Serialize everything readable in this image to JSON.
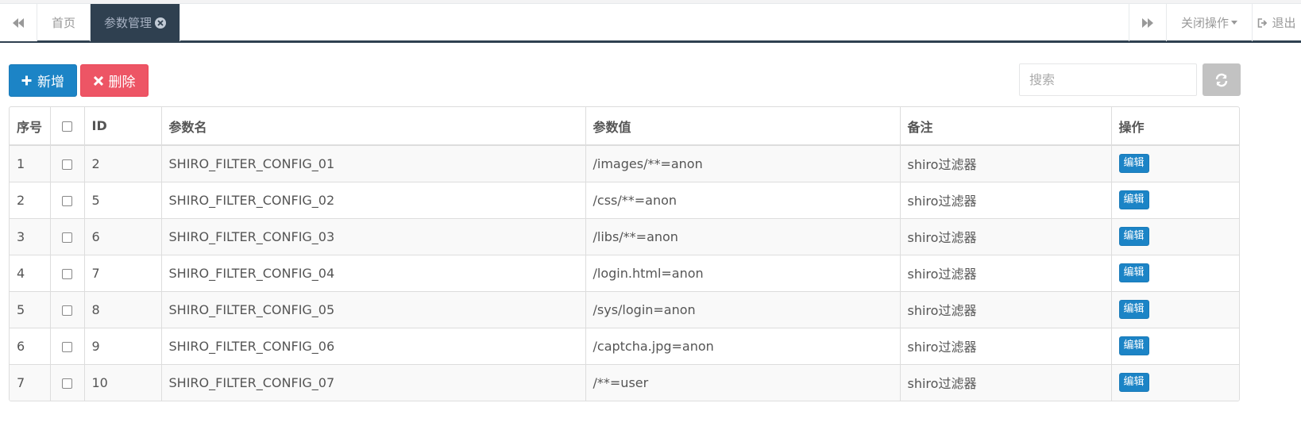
{
  "tabbar": {
    "tabs": [
      {
        "label": "首页",
        "active": false
      },
      {
        "label": "参数管理",
        "active": true
      }
    ],
    "close_ops_label": "关闭操作",
    "logout_label": "退出"
  },
  "toolbar": {
    "add_label": "新增",
    "delete_label": "删除",
    "search_placeholder": "搜索"
  },
  "table": {
    "headers": {
      "index": "序号",
      "id": "ID",
      "param_name": "参数名",
      "param_value": "参数值",
      "remark": "备注",
      "action": "操作"
    },
    "edit_label": "编辑",
    "rows": [
      {
        "index": "1",
        "id": "2",
        "param_name": "SHIRO_FILTER_CONFIG_01",
        "param_value": "/images/**=anon",
        "remark": "shiro过滤器"
      },
      {
        "index": "2",
        "id": "5",
        "param_name": "SHIRO_FILTER_CONFIG_02",
        "param_value": "/css/**=anon",
        "remark": "shiro过滤器"
      },
      {
        "index": "3",
        "id": "6",
        "param_name": "SHIRO_FILTER_CONFIG_03",
        "param_value": "/libs/**=anon",
        "remark": "shiro过滤器"
      },
      {
        "index": "4",
        "id": "7",
        "param_name": "SHIRO_FILTER_CONFIG_04",
        "param_value": "/login.html=anon",
        "remark": "shiro过滤器"
      },
      {
        "index": "5",
        "id": "8",
        "param_name": "SHIRO_FILTER_CONFIG_05",
        "param_value": "/sys/login=anon",
        "remark": "shiro过滤器"
      },
      {
        "index": "6",
        "id": "9",
        "param_name": "SHIRO_FILTER_CONFIG_06",
        "param_value": "/captcha.jpg=anon",
        "remark": "shiro过滤器"
      },
      {
        "index": "7",
        "id": "10",
        "param_name": "SHIRO_FILTER_CONFIG_07",
        "param_value": "/**=user",
        "remark": "shiro过滤器"
      }
    ]
  },
  "colors": {
    "primary": "#1c84c6",
    "danger": "#ed5565",
    "nav_dark": "#2f4050",
    "refresh_gray": "#c2c2c2"
  },
  "icons": {
    "tab_left": "backward-icon",
    "tab_close": "close-circle-icon",
    "tab_right": "forward-icon",
    "logout": "sign-out-icon",
    "add": "plus-icon",
    "delete": "times-icon",
    "refresh": "refresh-icon"
  }
}
